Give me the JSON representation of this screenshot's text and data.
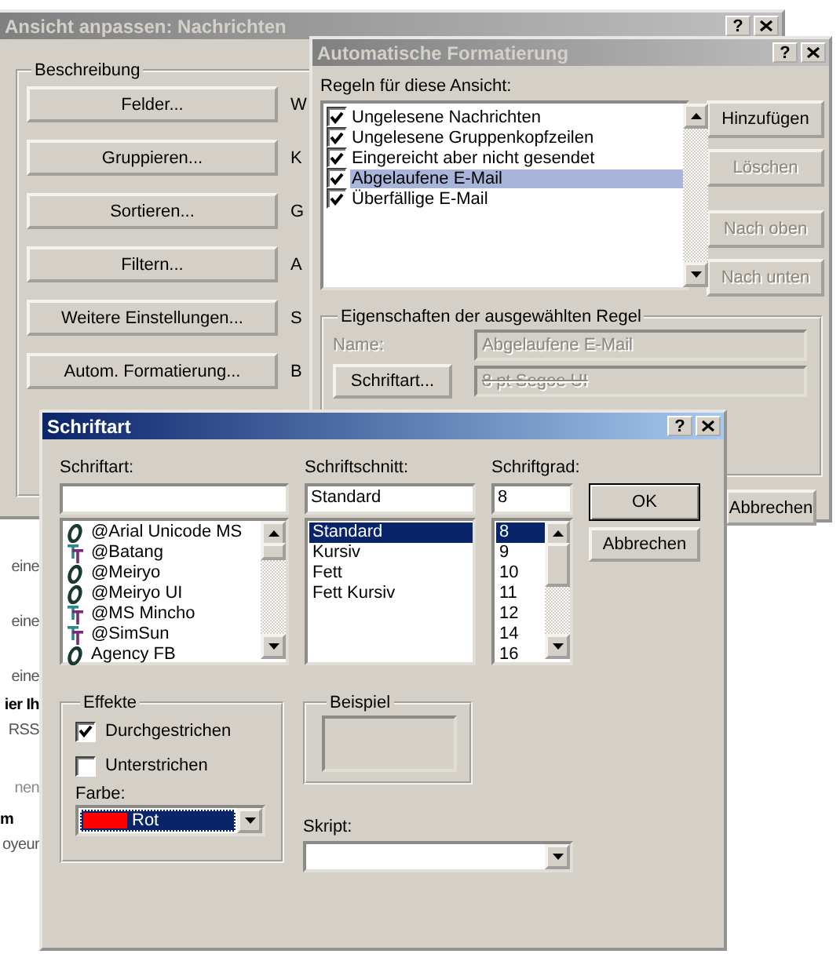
{
  "background_fragments": [
    {
      "text": "eine",
      "bold": false
    },
    {
      "text": "eine",
      "bold": false
    },
    {
      "text": "eine",
      "bold": false
    },
    {
      "text": "ier Ih",
      "bold": true
    },
    {
      "text": "RSS",
      "bold": false
    },
    {
      "text": "nen",
      "bold": false
    },
    {
      "text": "m",
      "bold": true
    },
    {
      "text": "oyeur",
      "bold": false
    }
  ],
  "view_dialog": {
    "title": "Ansicht anpassen: Nachrichten",
    "active": false,
    "help_button": "?",
    "group": "Beschreibung",
    "rows": [
      {
        "button": "Felder...",
        "description": "W"
      },
      {
        "button": "Gruppieren...",
        "description": "K"
      },
      {
        "button": "Sortieren...",
        "description": "G"
      },
      {
        "button": "Filtern...",
        "description": "A"
      },
      {
        "button": "Weitere Einstellungen...",
        "description": "S"
      },
      {
        "button": "Autom. Formatierung...",
        "description": "B"
      }
    ]
  },
  "autoformat_dialog": {
    "title": "Automatische Formatierung",
    "active": false,
    "help_button": "?",
    "rules_label": "Regeln für diese Ansicht:",
    "rules": [
      {
        "label": "Ungelesene Nachrichten",
        "checked": true,
        "selected": false
      },
      {
        "label": "Ungelesene Gruppenkopfzeilen",
        "checked": true,
        "selected": false
      },
      {
        "label": "Eingereicht aber nicht gesendet",
        "checked": true,
        "selected": false
      },
      {
        "label": "Abgelaufene E-Mail",
        "checked": true,
        "selected": true
      },
      {
        "label": "Überfällige E-Mail",
        "checked": true,
        "selected": false
      }
    ],
    "buttons": [
      {
        "label": "Hinzufügen",
        "disabled": false
      },
      {
        "label": "Löschen",
        "disabled": true
      },
      {
        "label": "Nach oben",
        "disabled": true
      },
      {
        "label": "Nach unten",
        "disabled": true
      }
    ],
    "properties": {
      "group": "Eigenschaften der ausgewählten Regel",
      "disabled": true,
      "name_label": "Name:",
      "name_value": "Abgelaufene E-Mail",
      "font_button": "Schriftart...",
      "font_value": "8 pt Segoe UI",
      "font_value_struck": true
    },
    "cancel_button": "Abbrechen"
  },
  "font_dialog": {
    "title": "Schriftart",
    "active": true,
    "help_button": "?",
    "font": {
      "label": "Schriftart:",
      "items": [
        {
          "name": "@Arial Unicode MS",
          "kind": "opentype",
          "selected": false
        },
        {
          "name": "@Batang",
          "kind": "truetype",
          "selected": false
        },
        {
          "name": "@Meiryo",
          "kind": "opentype",
          "selected": false
        },
        {
          "name": "@Meiryo UI",
          "kind": "opentype",
          "selected": false
        },
        {
          "name": "@MS Mincho",
          "kind": "truetype",
          "selected": false
        },
        {
          "name": "@SimSun",
          "kind": "truetype",
          "selected": false
        },
        {
          "name": "Agency FB",
          "kind": "opentype",
          "selected": false
        }
      ]
    },
    "style": {
      "label": "Schriftschnitt:",
      "value": "Standard",
      "items": [
        {
          "name": "Standard",
          "selected": true
        },
        {
          "name": "Kursiv",
          "selected": false
        },
        {
          "name": "Fett",
          "selected": false
        },
        {
          "name": "Fett Kursiv",
          "selected": false
        }
      ]
    },
    "size": {
      "label": "Schriftgrad:",
      "value": "8",
      "items": [
        {
          "name": "8",
          "selected": true
        },
        {
          "name": "9",
          "selected": false
        },
        {
          "name": "10",
          "selected": false
        },
        {
          "name": "11",
          "selected": false
        },
        {
          "name": "12",
          "selected": false
        },
        {
          "name": "14",
          "selected": false
        },
        {
          "name": "16",
          "selected": false
        }
      ]
    },
    "ok_button": "OK",
    "cancel_button": "Abbrechen",
    "effects": {
      "group": "Effekte",
      "options": [
        {
          "label": "Durchgestrichen",
          "checked": true
        },
        {
          "label": "Unterstrichen",
          "checked": false
        }
      ],
      "color_label": "Farbe:",
      "color": {
        "name": "Rot",
        "color": "#ff0000"
      }
    },
    "sample": {
      "group": "Beispiel"
    },
    "script": {
      "label": "Skript:"
    }
  }
}
